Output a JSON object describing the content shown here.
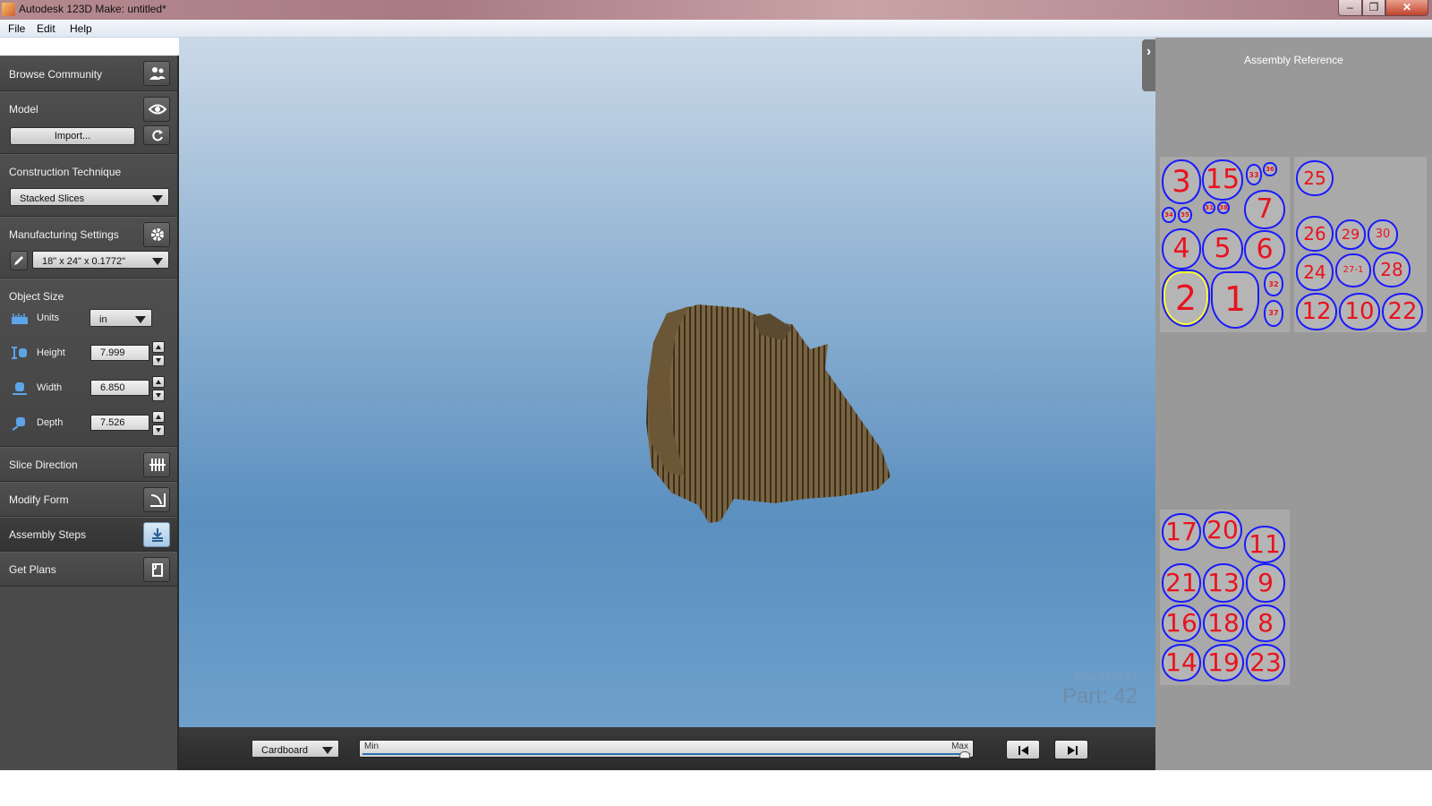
{
  "window": {
    "title": "Autodesk 123D Make: untitled*"
  },
  "menu": [
    "File",
    "Edit",
    "Help"
  ],
  "sidebar": {
    "browse_community": "Browse Community",
    "model": "Model",
    "import_button": "Import...",
    "construction_technique": "Construction Technique",
    "technique_value": "Stacked Slices",
    "manufacturing_settings": "Manufacturing Settings",
    "sheet_value": "18\" x 24\" x 0.1772\"",
    "object_size": "Object Size",
    "units_label": "Units",
    "units_value": "in",
    "height_label": "Height",
    "height_value": "7.999",
    "width_label": "Width",
    "width_value": "6.850",
    "depth_label": "Depth",
    "depth_value": "7.526",
    "slice_direction": "Slice Direction",
    "modify_form": "Modify Form",
    "assembly_steps": "Assembly Steps",
    "get_plans": "Get Plans"
  },
  "viewport": {
    "step_text": "Step 44 of 44",
    "part_text": "Part: 42",
    "model_color": "#7a6440"
  },
  "bottombar": {
    "material": "Cardboard",
    "slider_min": "Min",
    "slider_max": "Max",
    "slider_position": 1.0
  },
  "right_panel": {
    "title": "Assembly Reference",
    "outline_color": "#1a1aff",
    "number_color": "#e8131f",
    "sheet1": [
      "3",
      "15",
      "33",
      "36",
      "7",
      "34",
      "35",
      "31",
      "38",
      "4",
      "5",
      "6",
      "2",
      "1",
      "32",
      "37"
    ],
    "sheet2": [
      "25",
      "26",
      "29",
      "30",
      "24",
      "27-1",
      "28",
      "12",
      "10",
      "22"
    ],
    "sheet3": [
      "17",
      "20",
      "11",
      "21",
      "13",
      "9",
      "16",
      "18",
      "8",
      "14",
      "19",
      "23"
    ]
  }
}
